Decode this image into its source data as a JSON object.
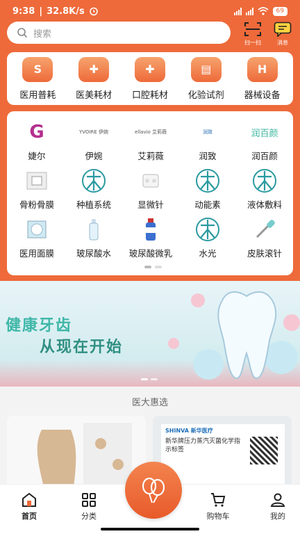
{
  "status_bar": {
    "time": "9:38",
    "speed": "32.8K/s",
    "battery": "69"
  },
  "header": {
    "search_placeholder": "搜索",
    "scan_label": "扫一扫",
    "message_label": "消息"
  },
  "categories": [
    {
      "label": "医用普耗",
      "glyph": "S"
    },
    {
      "label": "医美耗材",
      "glyph": "✚"
    },
    {
      "label": "口腔耗材",
      "glyph": "✚"
    },
    {
      "label": "化验试剂",
      "glyph": "▤"
    },
    {
      "label": "器械设备",
      "glyph": "H"
    }
  ],
  "brands": [
    {
      "label": "婕尔",
      "logo_text": "G"
    },
    {
      "label": "伊婉",
      "logo_text": "YVOIRE 伊婉"
    },
    {
      "label": "艾莉薇",
      "logo_text": "ellavio 艾莉薇"
    },
    {
      "label": "润致",
      "logo_text": "润致"
    },
    {
      "label": "润百颜",
      "logo_text": "润百颜"
    },
    {
      "label": "骨粉骨膜",
      "logo_text": ""
    },
    {
      "label": "种植系统",
      "logo_text": ""
    },
    {
      "label": "显微针",
      "logo_text": ""
    },
    {
      "label": "动能素",
      "logo_text": ""
    },
    {
      "label": "液体敷料",
      "logo_text": ""
    },
    {
      "label": "医用面膜",
      "logo_text": ""
    },
    {
      "label": "玻尿酸水",
      "logo_text": ""
    },
    {
      "label": "玻尿酸微乳",
      "logo_text": ""
    },
    {
      "label": "水光",
      "logo_text": ""
    },
    {
      "label": "皮肤滚针",
      "logo_text": ""
    }
  ],
  "banner": {
    "line1": "健康牙齿",
    "line2": "从现在开始"
  },
  "section_title": "医大惠选",
  "products": [
    {
      "image": "shapewear-product-image"
    },
    {
      "image": "indicator-label-product-image",
      "brand": "SHINVA 新华医疗",
      "title": "新华牌压力蒸汽灭菌化学指示标签"
    }
  ],
  "tabs": [
    {
      "label": "首页",
      "active": true
    },
    {
      "label": "分类",
      "active": false
    },
    {
      "label": "购物车",
      "active": false
    },
    {
      "label": "我的",
      "active": false
    }
  ],
  "colors": {
    "accent": "#ee6a3a",
    "teal": "#2a9aa0"
  }
}
